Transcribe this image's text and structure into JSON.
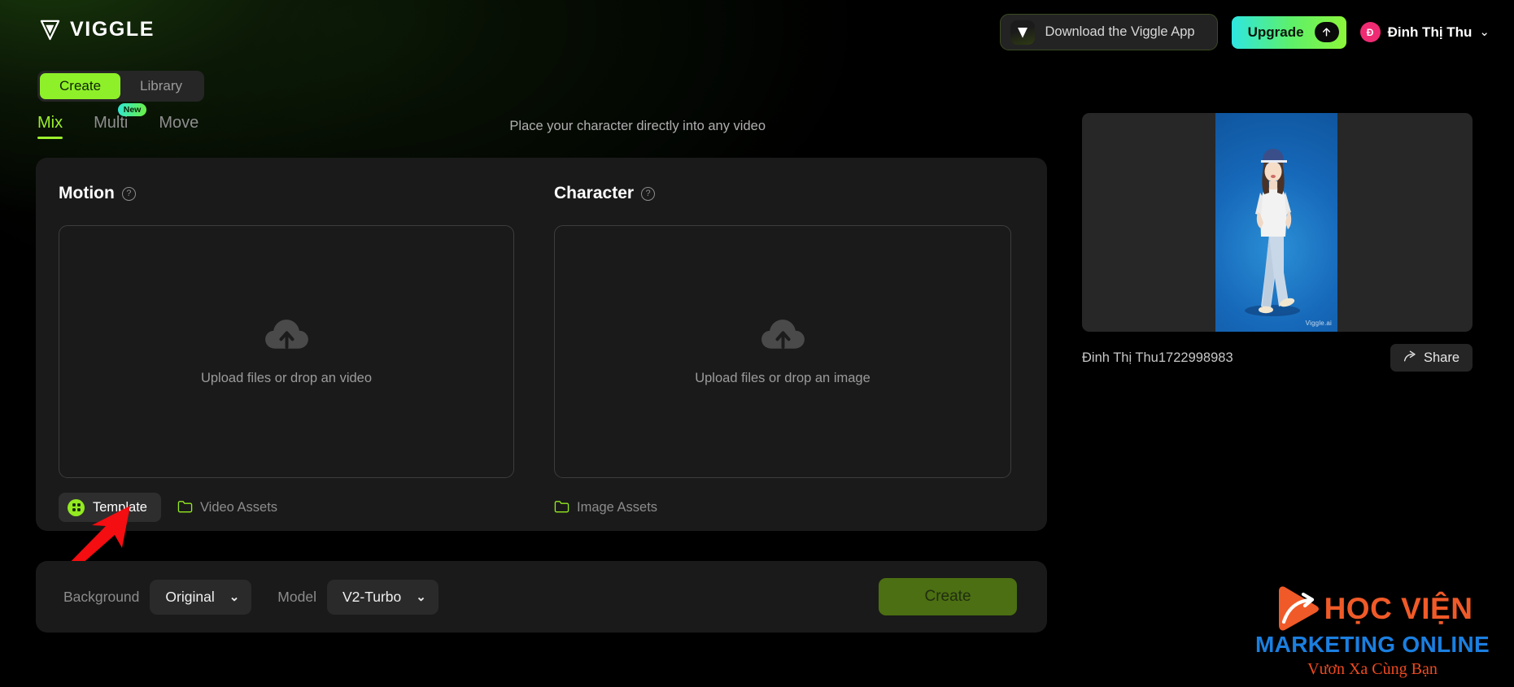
{
  "header": {
    "brand": "VIGGLE",
    "brand_icon": "viggle-logo-icon",
    "download_app": {
      "label": "Download the Viggle App",
      "icon": "viggle-app-icon"
    },
    "upgrade": {
      "label": "Upgrade",
      "icon": "arrow-up-icon"
    },
    "user": {
      "avatar_initial": "Đ",
      "name": "Đinh Thị Thu",
      "chevron": "⌄",
      "avatar_color": "#ef2b73"
    }
  },
  "mode_switch": {
    "items": [
      {
        "label": "Create",
        "active": true
      },
      {
        "label": "Library",
        "active": false
      }
    ]
  },
  "subtabs": {
    "items": [
      {
        "label": "Mix",
        "active": true,
        "badge": ""
      },
      {
        "label": "Multi",
        "active": false,
        "badge": "New"
      },
      {
        "label": "Move",
        "active": false,
        "badge": ""
      }
    ]
  },
  "tagline": "Place your character directly into any video",
  "editor": {
    "motion": {
      "title": "Motion",
      "help_icon": "question-circle-icon",
      "dropzone_icon": "cloud-upload-icon",
      "dropzone_label": "Upload files or drop an video",
      "template_button": {
        "label": "Template",
        "icon": "grid-icon"
      },
      "assets_link": {
        "label": "Video Assets",
        "icon": "folder-icon"
      }
    },
    "character": {
      "title": "Character",
      "help_icon": "question-circle-icon",
      "dropzone_icon": "cloud-upload-icon",
      "dropzone_label": "Upload files or drop an image",
      "assets_link": {
        "label": "Image Assets",
        "icon": "folder-icon"
      }
    }
  },
  "settings": {
    "background": {
      "label": "Background",
      "value": "Original",
      "chevron": "⌄"
    },
    "model": {
      "label": "Model",
      "value": "V2-Turbo",
      "chevron": "⌄"
    },
    "create_button": {
      "label": "Create",
      "disabled": true,
      "color": "#4b6f12"
    }
  },
  "preview": {
    "title": "Đinh Thị Thu1722998983",
    "watermark": "Viggle.ai",
    "share": {
      "label": "Share",
      "icon": "share-arrow-icon"
    }
  },
  "annotation": {
    "arrow_icon": "red-arrow-icon",
    "arrow_color": "#f40d11",
    "points_at": "Template"
  },
  "brand_watermark": {
    "icon": "play-button-arrow-icon",
    "line1": "HỌC VIỆN",
    "line2": "MARKETING ONLINE",
    "line3": "Vươn Xa Cùng Bạn",
    "line1_color": "#f05a28",
    "line2_color": "#1b7fe0",
    "line3_color": "#ef4a20"
  }
}
